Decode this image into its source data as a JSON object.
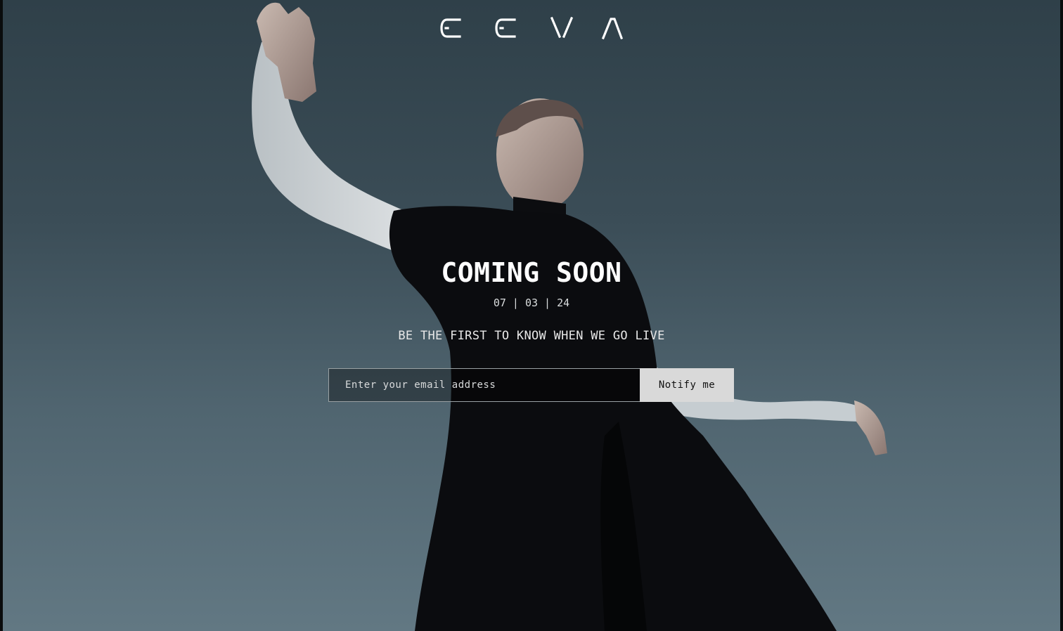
{
  "brand": {
    "logo_text": "CCVA"
  },
  "hero": {
    "headline": "COMING SOON",
    "launch_date": "07 | 03 | 24",
    "tagline": "BE THE FIRST TO KNOW WHEN WE GO LIVE"
  },
  "signup": {
    "email_placeholder": "Enter your email address",
    "email_value": "",
    "button_label": "Notify me"
  },
  "colors": {
    "sky_top": "#2f4049",
    "sky_bottom": "#627883",
    "button_bg": "#d9d9d9",
    "text": "#ffffff"
  }
}
